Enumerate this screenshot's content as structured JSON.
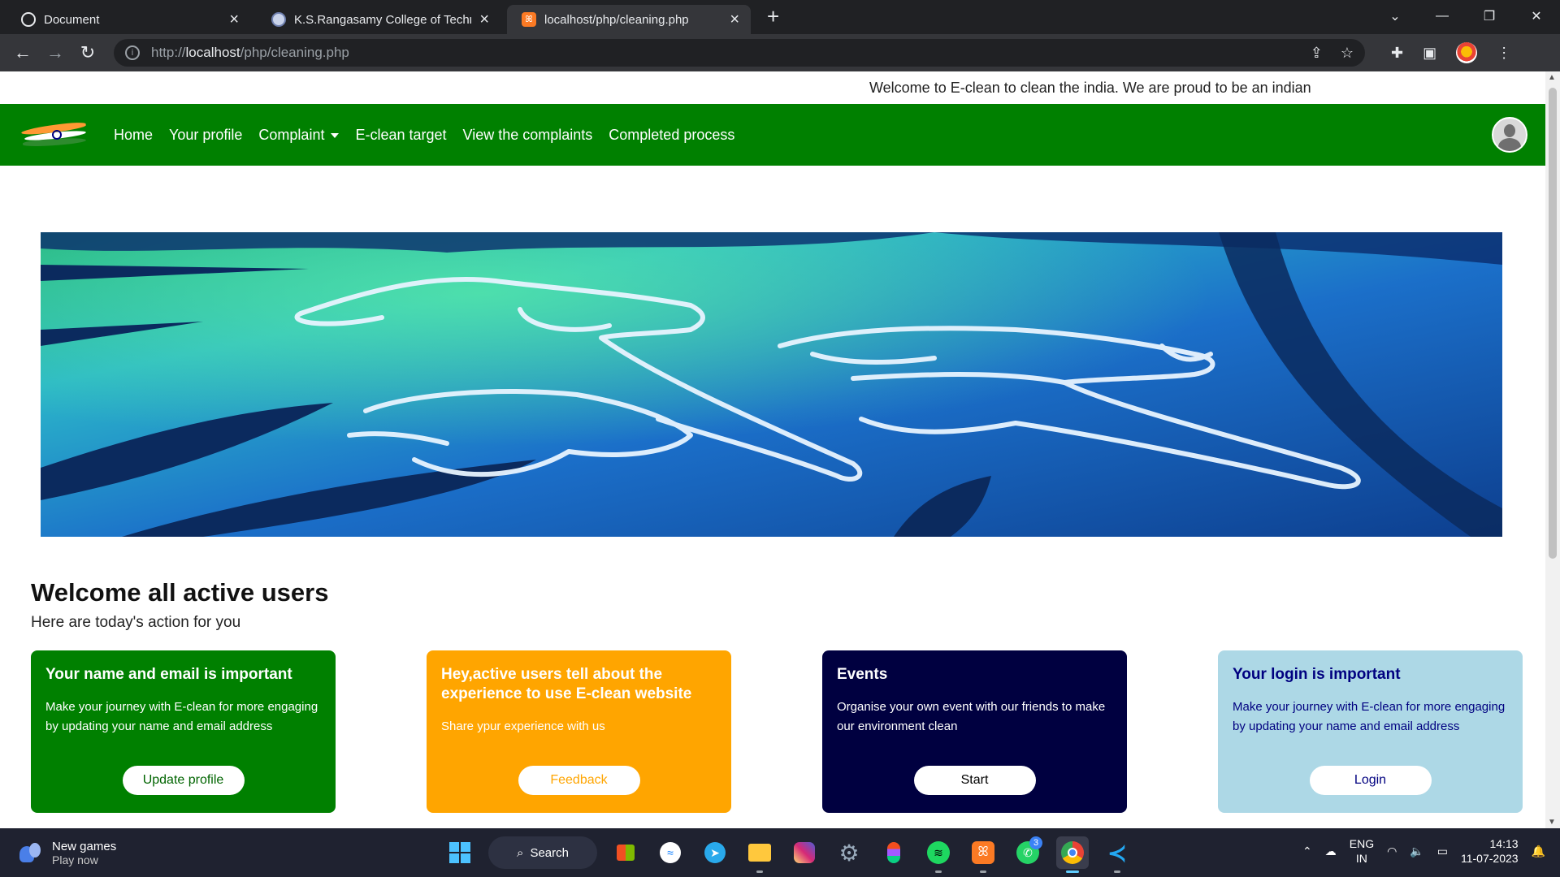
{
  "browser": {
    "tabs": [
      {
        "title": "Document",
        "active": false
      },
      {
        "title": "K.S.Rangasamy College of Techno",
        "active": false
      },
      {
        "title": "localhost/php/cleaning.php",
        "active": true
      }
    ],
    "url_prefix": "http://",
    "url_host": "localhost",
    "url_path": "/php/cleaning.php"
  },
  "site": {
    "welcome_text": "Welcome to E-clean to clean the india. We are proud to be an indian",
    "nav": {
      "home": "Home",
      "profile": "Your profile",
      "complaint": "Complaint",
      "target": "E-clean target",
      "view_complaints": "View the complaints",
      "completed": "Completed process"
    },
    "colors": {
      "nav_green": "#008000",
      "orange": "#ffa500",
      "navy": "#000040",
      "light_blue": "#add8e6"
    },
    "heading": "Welcome all active users",
    "subheading": "Here are today's action for you",
    "cards": [
      {
        "title": "Your name and email is important",
        "text": "Make your journey with E-clean for more engaging by updating your name and email address",
        "button": "Update profile"
      },
      {
        "title": "Hey,active users tell about the experience to use E-clean website",
        "text": "Share ypur experience with us",
        "button": "Feedback"
      },
      {
        "title": "Events",
        "text": "Organise your own event with our friends to make our environment clean",
        "button": "Start"
      },
      {
        "title": "Your login is important",
        "text": "Make your journey with E-clean for more engaging by updating your name and email address",
        "button": "Login"
      }
    ]
  },
  "taskbar": {
    "games_title": "New games",
    "games_sub": "Play now",
    "search_label": "Search",
    "whatsapp_badge": "3",
    "lang_top": "ENG",
    "lang_bottom": "IN",
    "time": "14:13",
    "date": "11-07-2023"
  }
}
